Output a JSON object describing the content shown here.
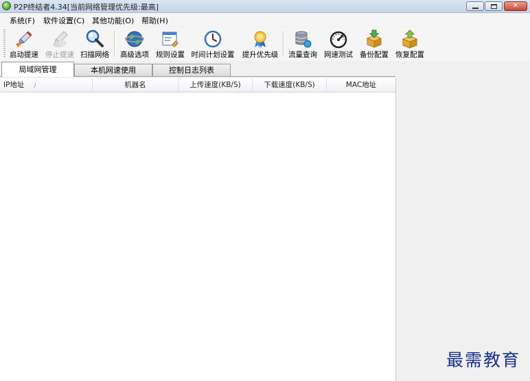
{
  "window": {
    "title": "P2P终结者4.34[当前网络管理优先级:最高]",
    "controls": {
      "close_glyph": "✕"
    }
  },
  "menu": [
    {
      "label": "系统(F)"
    },
    {
      "label": "软件设置(C)"
    },
    {
      "label": "其他功能(O)"
    },
    {
      "label": "帮助(H)"
    }
  ],
  "toolbar": {
    "buttons": [
      {
        "label": "启动提速",
        "icon": "rocket-launch-icon",
        "enabled": true
      },
      {
        "label": "停止提速",
        "icon": "rocket-stop-icon",
        "enabled": false
      },
      {
        "label": "扫描网络",
        "icon": "magnifier-icon",
        "enabled": true
      },
      {
        "label": "高级选项",
        "icon": "globe-icon",
        "enabled": true
      },
      {
        "label": "规则设置",
        "icon": "rules-window-icon",
        "enabled": true
      },
      {
        "label": "时间计划设置",
        "icon": "clock-icon",
        "enabled": true
      },
      {
        "label": "提升优先级",
        "icon": "award-ribbon-icon",
        "enabled": true
      },
      {
        "label": "流量查询",
        "icon": "database-icon",
        "enabled": true
      },
      {
        "label": "网速测试",
        "icon": "speedometer-icon",
        "enabled": true
      },
      {
        "label": "备份配置",
        "icon": "backup-box-icon",
        "enabled": true
      },
      {
        "label": "恢复配置",
        "icon": "restore-box-icon",
        "enabled": true
      }
    ]
  },
  "tabs": [
    {
      "label": "局域网管理",
      "active": true
    },
    {
      "label": "本机网速使用",
      "active": false
    },
    {
      "label": "控制日志列表",
      "active": false
    }
  ],
  "list": {
    "columns": [
      {
        "label": "IP地址",
        "sort_indicator": "/"
      },
      {
        "label": "机器名"
      },
      {
        "label": "上传速度(KB/S)"
      },
      {
        "label": "下载速度(KB/S)"
      },
      {
        "label": "MAC地址"
      }
    ],
    "rows": []
  },
  "watermark": "最需教育",
  "colors": {
    "accent_blue": "#1a2f8a",
    "title_gradient_top": "#dbe6f3",
    "close_red": "#c44a32"
  }
}
